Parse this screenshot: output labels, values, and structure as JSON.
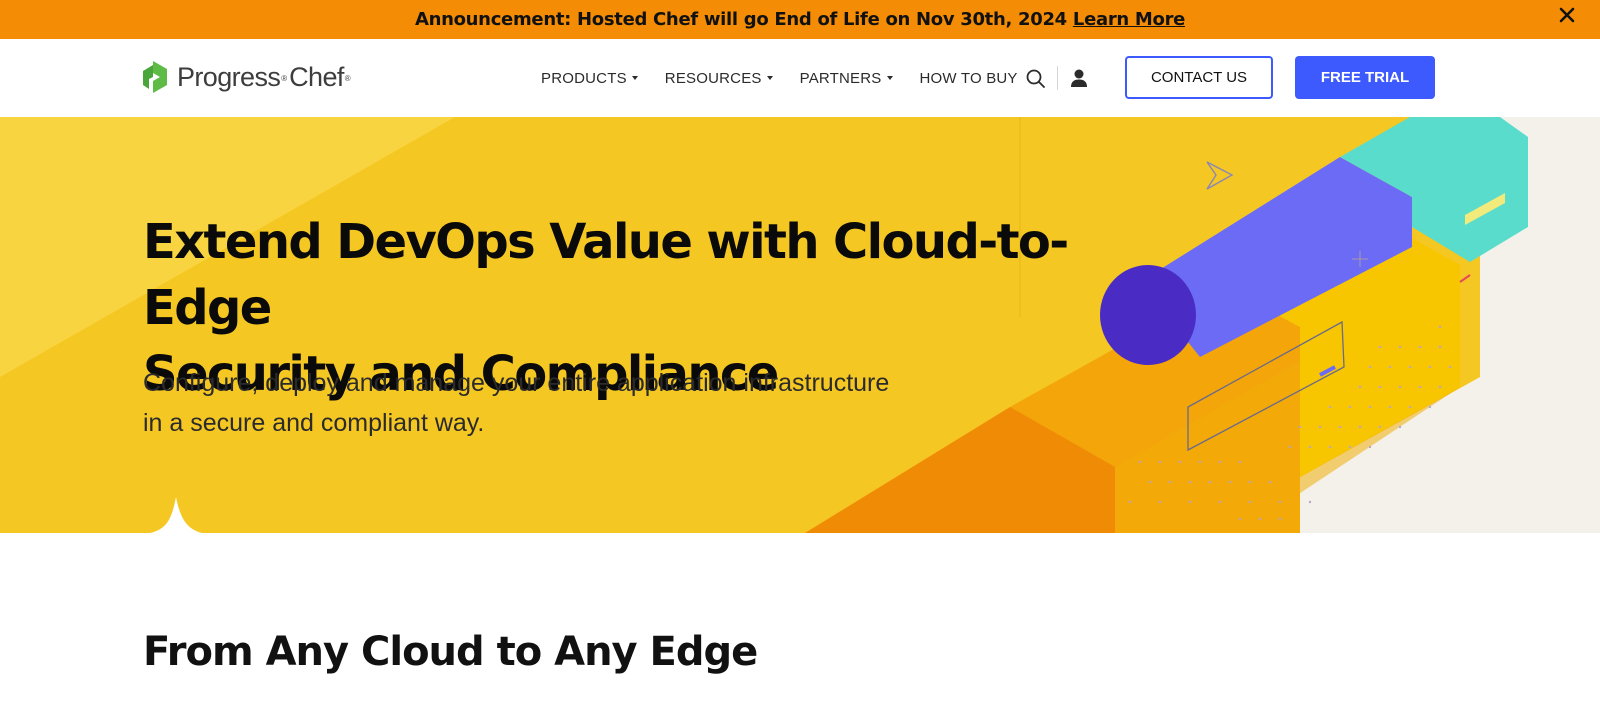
{
  "announcement": {
    "text": "Announcement: Hosted Chef will go End of Life on Nov 30th, 2024",
    "link_label": "Learn More",
    "close_symbol": "✕"
  },
  "header": {
    "logo": {
      "brand": "Progress",
      "product": "Chef",
      "reg": "®",
      "icon": "chef-logo-icon"
    },
    "nav": [
      {
        "label": "PRODUCTS",
        "has_dropdown": true
      },
      {
        "label": "RESOURCES",
        "has_dropdown": true
      },
      {
        "label": "PARTNERS",
        "has_dropdown": true
      },
      {
        "label": "HOW TO BUY",
        "has_dropdown": false
      }
    ],
    "search_icon": "search-icon",
    "user_icon": "user-icon",
    "contact_label": "CONTACT US",
    "trial_label": "FREE TRIAL"
  },
  "hero": {
    "title_line1": "Extend DevOps Value with Cloud-to-Edge",
    "title_line2": "Security and Compliance",
    "subtitle_line1": "Configure, deploy and manage your entire application infrastructure",
    "subtitle_line2": "in a secure and compliant way."
  },
  "section": {
    "title": "From Any Cloud to Any Edge"
  },
  "colors": {
    "announcement_bg": "#f48c06",
    "hero_bg": "#f5c723",
    "accent_blue": "#3d5afe",
    "logo_green": "#5dbb46"
  }
}
